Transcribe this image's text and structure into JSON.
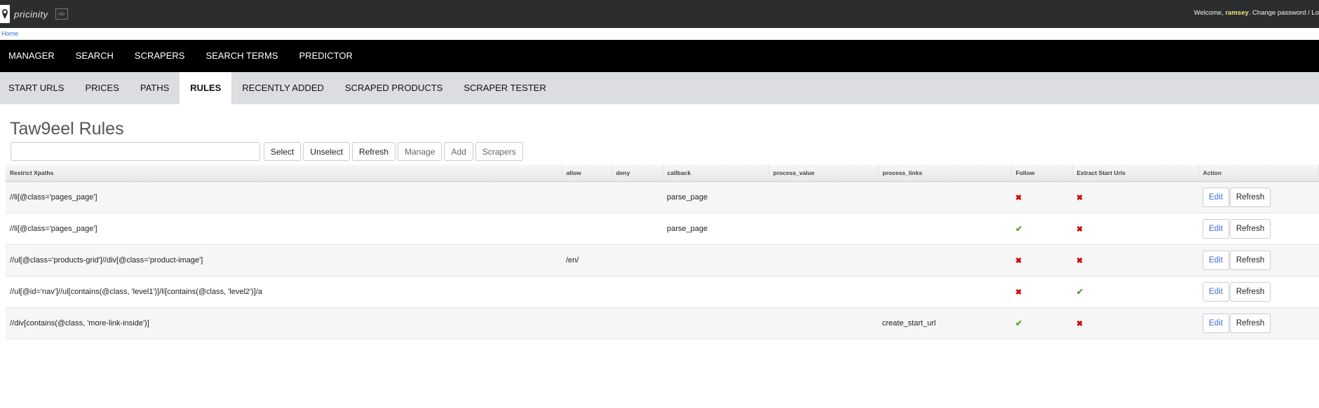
{
  "header": {
    "logo_text": "pricinity",
    "logo_badge": "wb",
    "welcome_prefix": "Welcome, ",
    "username": "ramsey",
    "change_password": "Change password",
    "separator": " / ",
    "logout": "Lo"
  },
  "breadcrumb": {
    "home": "Home"
  },
  "main_nav": [
    "MANAGER",
    "SEARCH",
    "SCRAPERS",
    "SEARCH TERMS",
    "PREDICTOR"
  ],
  "sub_nav": [
    "START URLS",
    "PRICES",
    "PATHS",
    "RULES",
    "RECENTLY ADDED",
    "SCRAPED PRODUCTS",
    "SCRAPER TESTER"
  ],
  "sub_nav_active": "RULES",
  "page": {
    "title": "Taw9eel Rules",
    "search_placeholder": "",
    "buttons": {
      "select": "Select",
      "unselect": "Unselect",
      "refresh": "Refresh",
      "manage": "Manage",
      "add": "Add",
      "scrapers": "Scrapers"
    }
  },
  "table": {
    "columns": [
      "Restrict Xpaths",
      "allow",
      "deny",
      "callback",
      "process_value",
      "process_links",
      "Follow",
      "Extract Start Urls",
      "Action"
    ],
    "rows": [
      {
        "xpath": "//li[@class='pages_page']",
        "allow": "",
        "deny": "",
        "callback": "parse_page",
        "process_value": "",
        "process_links": "",
        "follow": "no",
        "extract": "no"
      },
      {
        "xpath": "//li[@class='pages_page']",
        "allow": "",
        "deny": "",
        "callback": "parse_page",
        "process_value": "",
        "process_links": "",
        "follow": "yes",
        "extract": "no"
      },
      {
        "xpath": "//ul[@class='products-grid']//div[@class='product-image']",
        "allow": "/en/",
        "deny": "",
        "callback": "",
        "process_value": "",
        "process_links": "",
        "follow": "no",
        "extract": "no"
      },
      {
        "xpath": "//ul[@id='nav']//ul[contains(@class, 'level1')]/li[contains(@class, 'level2')]/a",
        "allow": "",
        "deny": "",
        "callback": "",
        "process_value": "",
        "process_links": "",
        "follow": "no",
        "extract": "yes"
      },
      {
        "xpath": "//div[contains(@class, 'more-link-inside')]",
        "allow": "",
        "deny": "",
        "callback": "",
        "process_value": "",
        "process_links": "create_start_url",
        "follow": "yes",
        "extract": "no"
      }
    ],
    "action_labels": {
      "edit": "Edit",
      "refresh": "Refresh"
    },
    "icons": {
      "yes": "check-icon",
      "no": "cross-icon"
    }
  }
}
